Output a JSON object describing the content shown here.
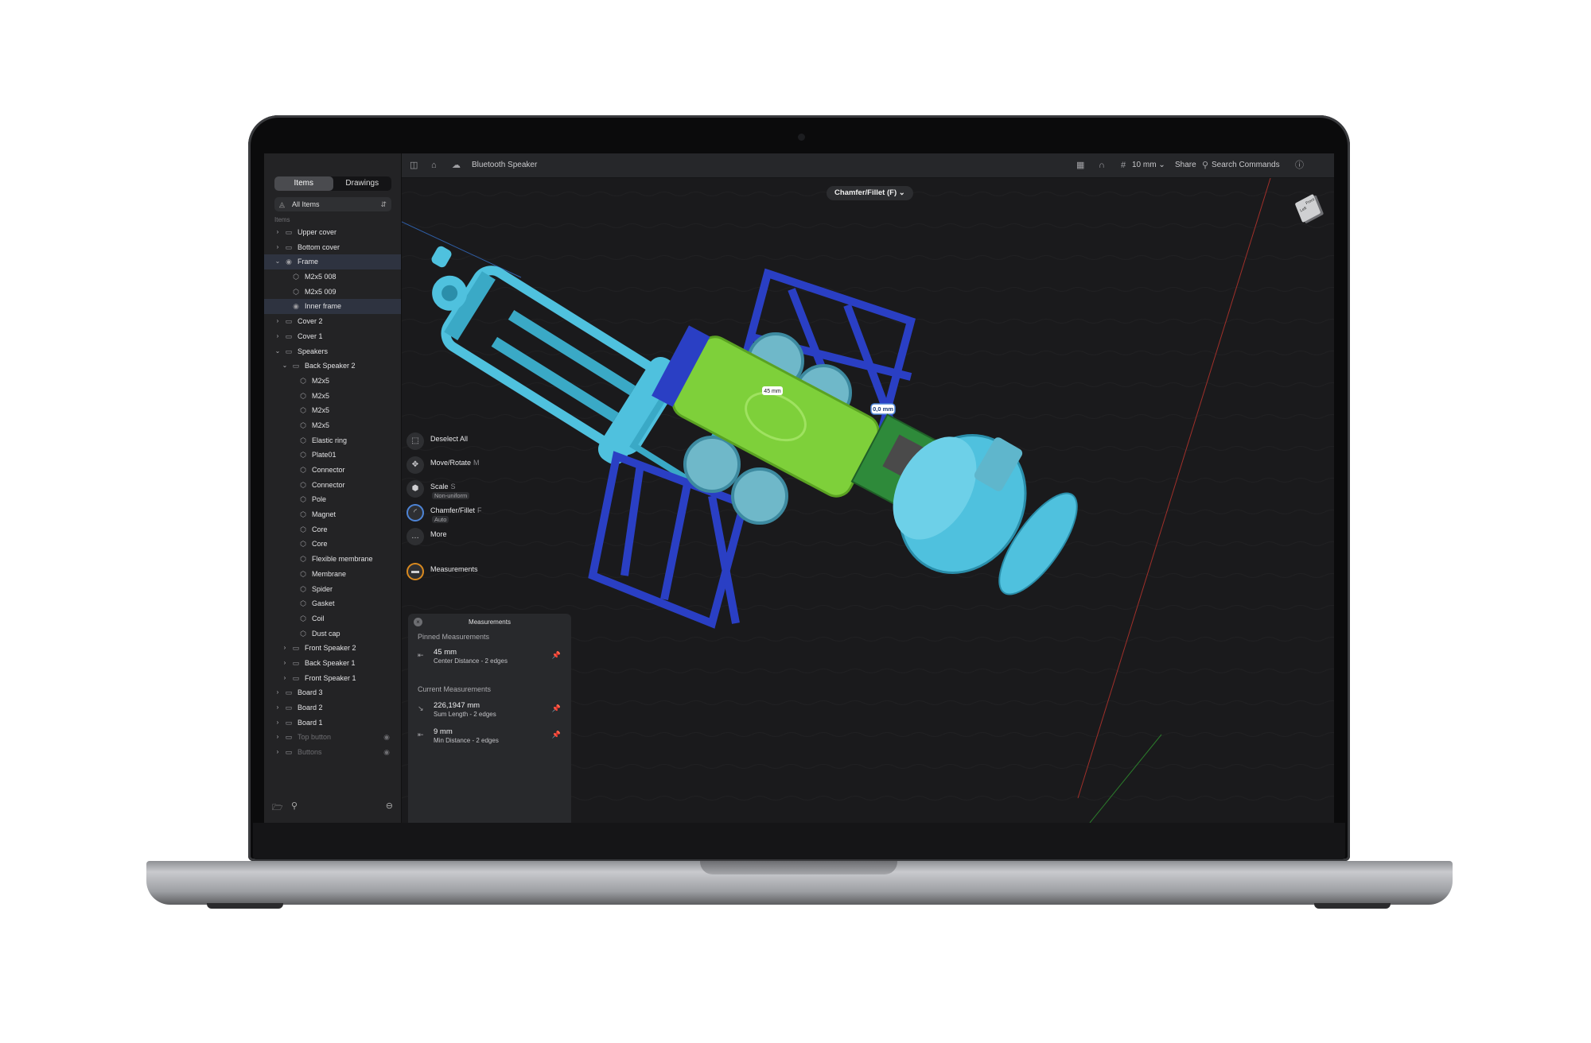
{
  "sidebar": {
    "tabs": [
      {
        "label": "Items",
        "active": true
      },
      {
        "label": "Drawings",
        "active": false
      }
    ],
    "filter": "All Items",
    "section_label": "Items",
    "tree": [
      {
        "label": "Upper cover",
        "depth": 0,
        "chevron": "right",
        "icon": "folder-icon"
      },
      {
        "label": "Bottom cover",
        "depth": 0,
        "chevron": "right",
        "icon": "folder-icon"
      },
      {
        "label": "Frame",
        "depth": 0,
        "chevron": "down",
        "icon": "body-icon",
        "selected": true
      },
      {
        "label": "M2x5 008",
        "depth": 1,
        "chevron": "",
        "icon": "part-icon"
      },
      {
        "label": "M2x5 009",
        "depth": 1,
        "chevron": "",
        "icon": "part-icon"
      },
      {
        "label": "Inner frame",
        "depth": 1,
        "chevron": "",
        "icon": "body-icon",
        "selected": true
      },
      {
        "label": "Cover 2",
        "depth": 0,
        "chevron": "right",
        "icon": "folder-icon"
      },
      {
        "label": "Cover 1",
        "depth": 0,
        "chevron": "right",
        "icon": "folder-icon"
      },
      {
        "label": "Speakers",
        "depth": 0,
        "chevron": "down",
        "icon": "folder-icon"
      },
      {
        "label": "Back Speaker 2",
        "depth": 1,
        "chevron": "down",
        "icon": "folder-icon"
      },
      {
        "label": "M2x5",
        "depth": 2,
        "chevron": "",
        "icon": "part-icon"
      },
      {
        "label": "M2x5",
        "depth": 2,
        "chevron": "",
        "icon": "part-icon"
      },
      {
        "label": "M2x5",
        "depth": 2,
        "chevron": "",
        "icon": "part-icon"
      },
      {
        "label": "M2x5",
        "depth": 2,
        "chevron": "",
        "icon": "part-icon"
      },
      {
        "label": "Elastic ring",
        "depth": 2,
        "chevron": "",
        "icon": "part-icon"
      },
      {
        "label": "Plate01",
        "depth": 2,
        "chevron": "",
        "icon": "part-icon"
      },
      {
        "label": "Connector",
        "depth": 2,
        "chevron": "",
        "icon": "part-icon"
      },
      {
        "label": "Connector",
        "depth": 2,
        "chevron": "",
        "icon": "part-icon"
      },
      {
        "label": "Pole",
        "depth": 2,
        "chevron": "",
        "icon": "part-icon"
      },
      {
        "label": "Magnet",
        "depth": 2,
        "chevron": "",
        "icon": "part-icon"
      },
      {
        "label": "Core",
        "depth": 2,
        "chevron": "",
        "icon": "part-icon"
      },
      {
        "label": "Core",
        "depth": 2,
        "chevron": "",
        "icon": "part-icon"
      },
      {
        "label": "Flexible membrane",
        "depth": 2,
        "chevron": "",
        "icon": "part-icon"
      },
      {
        "label": "Membrane",
        "depth": 2,
        "chevron": "",
        "icon": "part-icon"
      },
      {
        "label": "Spider",
        "depth": 2,
        "chevron": "",
        "icon": "part-icon"
      },
      {
        "label": "Gasket",
        "depth": 2,
        "chevron": "",
        "icon": "part-icon"
      },
      {
        "label": "Coil",
        "depth": 2,
        "chevron": "",
        "icon": "part-icon"
      },
      {
        "label": "Dust cap",
        "depth": 2,
        "chevron": "",
        "icon": "part-icon"
      },
      {
        "label": "Front Speaker 2",
        "depth": 1,
        "chevron": "right",
        "icon": "folder-icon"
      },
      {
        "label": "Back Speaker 1",
        "depth": 1,
        "chevron": "right",
        "icon": "folder-icon"
      },
      {
        "label": "Front Speaker 1",
        "depth": 1,
        "chevron": "right",
        "icon": "folder-icon"
      },
      {
        "label": "Board 3",
        "depth": 0,
        "chevron": "right",
        "icon": "folder-icon"
      },
      {
        "label": "Board 2",
        "depth": 0,
        "chevron": "right",
        "icon": "folder-icon"
      },
      {
        "label": "Board 1",
        "depth": 0,
        "chevron": "right",
        "icon": "folder-icon"
      },
      {
        "label": "Top button",
        "depth": 0,
        "chevron": "right",
        "icon": "folder-icon",
        "hidden": true
      },
      {
        "label": "Buttons",
        "depth": 0,
        "chevron": "right",
        "icon": "folder-icon",
        "hidden": true
      }
    ]
  },
  "topbar": {
    "document_title": "Bluetooth Speaker",
    "grid_size": "10 mm",
    "share_label": "Share",
    "search_label": "Search Commands"
  },
  "viewport": {
    "active_tool": "Chamfer/Fillet (F)",
    "dimension_label_1": "45 mm",
    "dimension_label_2": "0,0 mm",
    "cube_face_1": "Left",
    "cube_face_2": "Front"
  },
  "tools": [
    {
      "label": "Deselect All",
      "key": "",
      "sub": "",
      "style": "plain",
      "icon": "deselect-icon"
    },
    {
      "label": "Move/Rotate",
      "key": "M",
      "sub": "",
      "style": "plain",
      "icon": "move-icon"
    },
    {
      "label": "Scale",
      "key": "S",
      "sub": "Non-uniform",
      "style": "plain",
      "icon": "scale-icon"
    },
    {
      "label": "Chamfer/Fillet",
      "key": "F",
      "sub": "Auto",
      "style": "blue",
      "icon": "fillet-icon"
    },
    {
      "label": "More",
      "key": "",
      "sub": "",
      "style": "plain",
      "icon": "more-icon"
    },
    {
      "label": "Measurements",
      "key": "",
      "sub": "",
      "style": "ring",
      "icon": "ruler-icon"
    }
  ],
  "measurements_panel": {
    "title": "Measurements",
    "pinned_heading": "Pinned Measurements",
    "pinned": [
      {
        "value": "45 mm",
        "desc": "Center Distance - 2 edges"
      }
    ],
    "current_heading": "Current Measurements",
    "current": [
      {
        "value": "226,1947 mm",
        "desc": "Sum Length - 2 edges"
      },
      {
        "value": "9 mm",
        "desc": "Min Distance - 2 edges"
      }
    ]
  },
  "colors": {
    "cyan": "#4fc1de",
    "blue": "#2a3fc4",
    "green": "#7ed03a",
    "pcb": "#2e8a3a",
    "accent": "#d9891e"
  }
}
